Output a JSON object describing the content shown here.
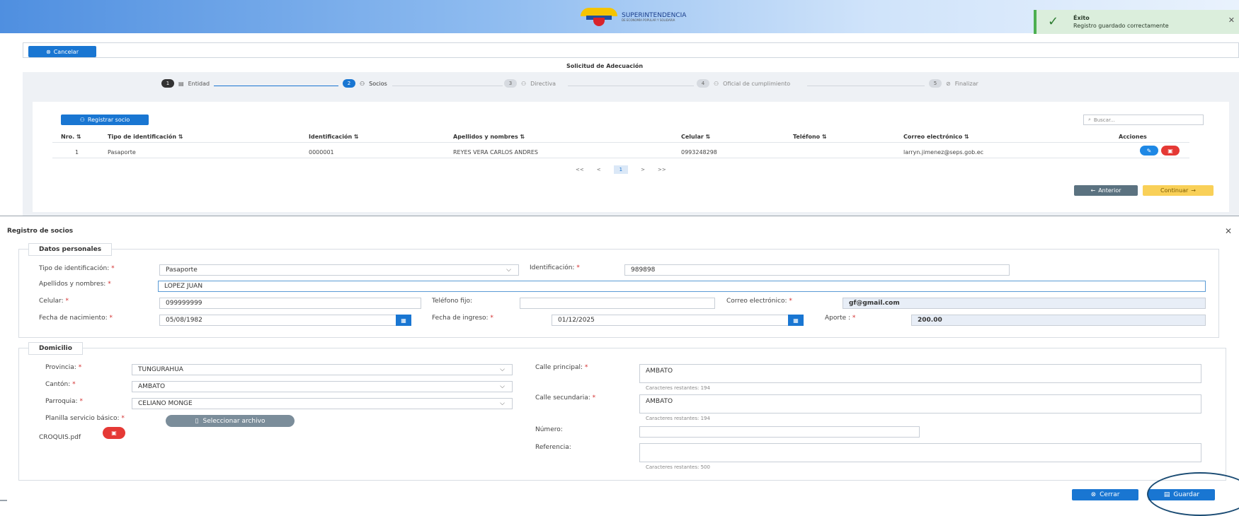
{
  "header": {
    "logo_text": "SUPERINTENDENCIA",
    "logo_sub": "DE ECONOMÍA POPULAR Y SOLIDARIA"
  },
  "toast": {
    "title": "Éxito",
    "message": "Registro guardado correctamente"
  },
  "wizard": {
    "cancel_label": "Cancelar",
    "title": "Solicitud de Adecuación",
    "steps": [
      {
        "num": "1",
        "label": "Entidad",
        "state": "done"
      },
      {
        "num": "2",
        "label": "Socios",
        "state": "active"
      },
      {
        "num": "3",
        "label": "Directiva",
        "state": "pending"
      },
      {
        "num": "4",
        "label": "Oficial de cumplimiento",
        "state": "pending"
      },
      {
        "num": "5",
        "label": "Finalizar",
        "state": "pending"
      }
    ],
    "register_button": "Registrar socio",
    "search_placeholder": "Buscar...",
    "columns": [
      "Nro. ⇅",
      "Tipo de identificación ⇅",
      "Identificación ⇅",
      "Apellidos y nombres ⇅",
      "Celular ⇅",
      "Teléfono ⇅",
      "Correo electrónico ⇅",
      "Acciones"
    ],
    "rows": [
      {
        "nro": "1",
        "tipo": "Pasaporte",
        "identificacion": "0000001",
        "nombres": "REYES VERA CARLOS ANDRES",
        "celular": "0993248298",
        "telefono": "",
        "correo": "larryn.jimenez@seps.gob.ec"
      }
    ],
    "pager": {
      "first": "<<",
      "prev": "<",
      "page": "1",
      "next": ">",
      "last": ">>"
    },
    "back_label": "Anterior",
    "continue_label": "Continuar"
  },
  "modal": {
    "title": "Registro de socios",
    "personal": {
      "legend": "Datos personales",
      "tipo_label": "Tipo de identificación:",
      "tipo_value": "Pasaporte",
      "id_label": "Identificación:",
      "id_value": "989898",
      "nombres_label": "Apellidos y nombres:",
      "nombres_value": "LOPEZ JUAN",
      "celular_label": "Celular:",
      "celular_value": "099999999",
      "telefono_label": "Teléfono fijo:",
      "telefono_value": "",
      "correo_label": "Correo electrónico:",
      "correo_value": "gf@gmail.com",
      "nacimiento_label": "Fecha de nacimiento:",
      "nacimiento_value": "05/08/1982",
      "ingreso_label": "Fecha de ingreso:",
      "ingreso_value": "01/12/2025",
      "aporte_label": "Aporte :",
      "aporte_value": "200.00"
    },
    "domicilio": {
      "legend": "Domicilio",
      "provincia_label": "Provincia:",
      "provincia_value": "TUNGURAHUA",
      "canton_label": "Cantón:",
      "canton_value": "AMBATO",
      "parroquia_label": "Parroquia:",
      "parroquia_value": "CELIANO MONGE",
      "planilla_label": "Planilla servicio básico:",
      "file_button": "Seleccionar archivo",
      "file_name": "CROQUIS.pdf",
      "calle_principal_label": "Calle principal:",
      "calle_principal_value": "AMBATO",
      "calle_principal_hint": "Caracteres restantes: 194",
      "calle_secundaria_label": "Calle secundaria:",
      "calle_secundaria_value": "AMBATO",
      "calle_secundaria_hint": "Caracteres restantes: 194",
      "numero_label": "Número:",
      "numero_value": "",
      "referencia_label": "Referencia:",
      "referencia_value": "",
      "referencia_hint": "Caracteres restantes: 500"
    },
    "cerrar_label": "Cerrar",
    "guardar_label": "Guardar"
  }
}
